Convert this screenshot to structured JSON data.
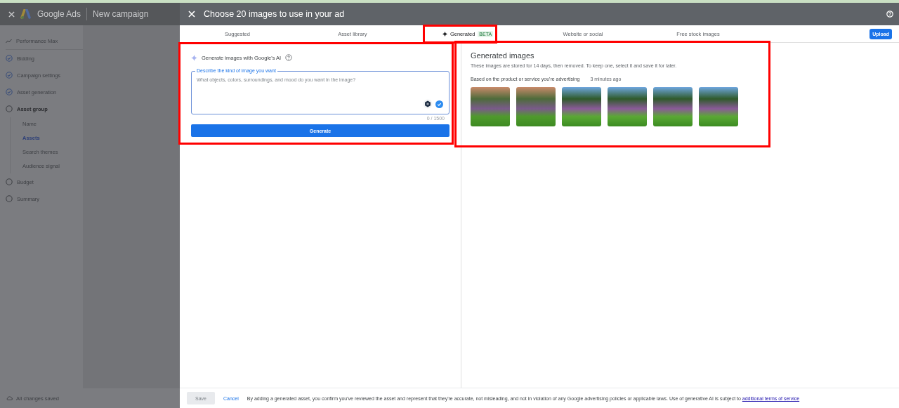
{
  "app_header": {
    "product": "Google Ads",
    "page": "New campaign"
  },
  "sidebar": {
    "steps": [
      {
        "label": "Performance Max",
        "kind": "type",
        "current": false
      },
      {
        "label": "Bidding",
        "kind": "step",
        "complete": true,
        "current": false
      },
      {
        "label": "Campaign settings",
        "kind": "step",
        "complete": true,
        "current": false
      },
      {
        "label": "Asset generation",
        "kind": "step",
        "complete": true,
        "current": false
      },
      {
        "label": "Asset group",
        "kind": "step",
        "complete": false,
        "current": true,
        "children": [
          {
            "label": "Name",
            "selected": false
          },
          {
            "label": "Assets",
            "selected": true
          },
          {
            "label": "Search themes",
            "selected": false
          },
          {
            "label": "Audience signal",
            "selected": false
          }
        ]
      },
      {
        "label": "Budget",
        "kind": "step",
        "complete": false,
        "current": false
      },
      {
        "label": "Summary",
        "kind": "step",
        "complete": false,
        "current": false
      }
    ],
    "save_status": "All changes saved"
  },
  "dialog": {
    "title": "Choose 20 images to use in your ad",
    "tabs": [
      {
        "label": "Suggested",
        "selected": false,
        "kind": "plain",
        "highlighted": false
      },
      {
        "label": "Asset library",
        "selected": false,
        "kind": "plain",
        "highlighted": false
      },
      {
        "label": "Generated",
        "selected": true,
        "kind": "ai",
        "badge": "BETA",
        "highlighted": true
      },
      {
        "label": "Website or social",
        "selected": false,
        "kind": "plain",
        "highlighted": false
      },
      {
        "label": "Free stock images",
        "selected": false,
        "kind": "plain",
        "highlighted": false
      }
    ],
    "upload_button": "Upload",
    "generator": {
      "highlighted": true,
      "heading": "Generate images with Google's AI",
      "field_label": "Describe the kind of image you want",
      "placeholder": "What objects, colors, surroundings, and mood do you want in the image?",
      "focused": true,
      "counter": "0 / 1500",
      "button": "Generate"
    },
    "results": {
      "highlighted": true,
      "title": "Generated images",
      "description": "These images are stored for 14 days, then removed. To keep one, select it and save it for later.",
      "group_label": "Based on the product or service you're advertising",
      "time": "3 minutes ago",
      "images": [
        {
          "kind": "sunset"
        },
        {
          "kind": "sunset"
        },
        {
          "kind": "day"
        },
        {
          "kind": "day"
        },
        {
          "kind": "day"
        },
        {
          "kind": "day"
        }
      ]
    },
    "footer": {
      "save": {
        "label": "Save",
        "disabled": true
      },
      "cancel": "Cancel",
      "disclaimer": "By adding a generated asset, you confirm you've reviewed the asset and represent that they're accurate, not misleading, and not in violation of any Google advertising policies or applicable laws. Use of generative AI is subject to",
      "link": "additional terms of service"
    }
  }
}
